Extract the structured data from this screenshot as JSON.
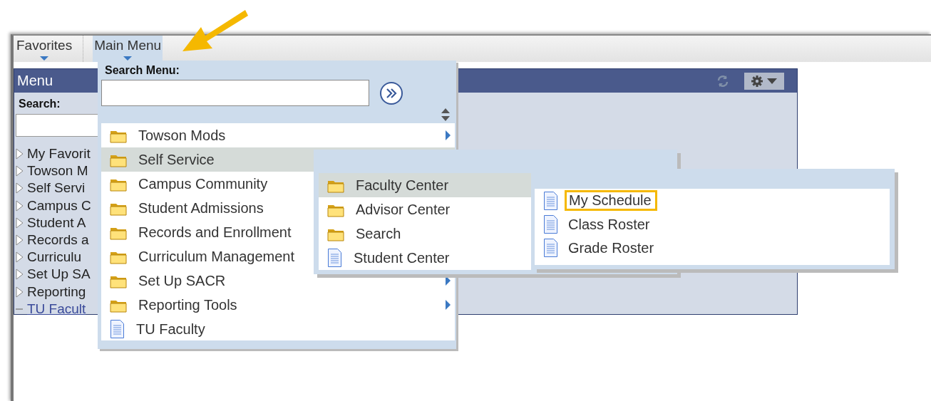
{
  "nav": [
    {
      "label": "Favorites",
      "selected": false
    },
    {
      "label": "Main Menu",
      "selected": true
    }
  ],
  "portal_panel": {
    "title": "Menu",
    "search_label": "Search:",
    "tree": [
      {
        "label": "My Favorit",
        "kind": "folder"
      },
      {
        "label": "Towson M",
        "kind": "folder"
      },
      {
        "label": "Self Servi",
        "kind": "folder"
      },
      {
        "label": "Campus C",
        "kind": "folder"
      },
      {
        "label": "Student A",
        "kind": "folder"
      },
      {
        "label": "Records a",
        "kind": "folder"
      },
      {
        "label": "Curriculu",
        "kind": "folder"
      },
      {
        "label": "Set Up SA",
        "kind": "folder"
      },
      {
        "label": "Reporting",
        "kind": "folder"
      },
      {
        "label": "TU Facult",
        "kind": "link"
      }
    ]
  },
  "main_menu": {
    "search_label": "Search Menu:",
    "items": [
      {
        "label": "Towson Mods",
        "kind": "folder",
        "arrow": true,
        "selected": false
      },
      {
        "label": "Self Service",
        "kind": "folder",
        "arrow": false,
        "selected": true
      },
      {
        "label": "Campus Community",
        "kind": "folder",
        "arrow": false,
        "selected": false
      },
      {
        "label": "Student Admissions",
        "kind": "folder",
        "arrow": false,
        "selected": false
      },
      {
        "label": "Records and Enrollment",
        "kind": "folder",
        "arrow": false,
        "selected": false
      },
      {
        "label": "Curriculum Management",
        "kind": "folder",
        "arrow": false,
        "selected": false
      },
      {
        "label": "Set Up SACR",
        "kind": "folder",
        "arrow": true,
        "selected": false
      },
      {
        "label": "Reporting Tools",
        "kind": "folder",
        "arrow": true,
        "selected": false
      },
      {
        "label": "TU Faculty",
        "kind": "page",
        "arrow": false,
        "selected": false
      }
    ]
  },
  "submenus": [
    {
      "items": [
        {
          "label": "Faculty Center",
          "kind": "folder",
          "selected": true,
          "highlighted": false
        },
        {
          "label": "Advisor Center",
          "kind": "folder",
          "selected": false,
          "highlighted": false
        },
        {
          "label": "Search",
          "kind": "folder",
          "selected": false,
          "highlighted": false
        },
        {
          "label": "Student Center",
          "kind": "page",
          "selected": false,
          "highlighted": false
        }
      ]
    },
    {
      "items": [
        {
          "label": "My Schedule",
          "kind": "page",
          "selected": false,
          "highlighted": true
        },
        {
          "label": "Class Roster",
          "kind": "page",
          "selected": false,
          "highlighted": false
        },
        {
          "label": "Grade Roster",
          "kind": "page",
          "selected": false,
          "highlighted": false
        }
      ]
    }
  ]
}
